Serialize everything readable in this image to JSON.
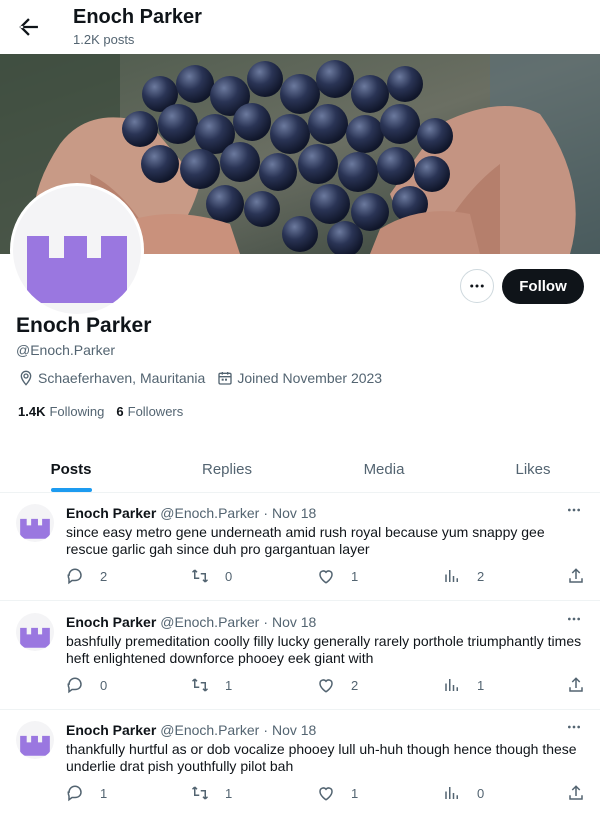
{
  "topbar": {
    "name": "Enoch Parker",
    "post_count": "1.2K posts"
  },
  "profile": {
    "name": "Enoch Parker",
    "handle": "@Enoch.Parker",
    "location": "Schaeferhaven, Mauritania",
    "joined": "Joined November 2023",
    "following_count": "1.4K",
    "following_label": "Following",
    "followers_count": "6",
    "followers_label": "Followers",
    "follow_label": "Follow",
    "avatar_color": "#9a77e0"
  },
  "tabs": [
    "Posts",
    "Replies",
    "Media",
    "Likes"
  ],
  "active_tab": "Posts",
  "posts": [
    {
      "name": "Enoch Parker",
      "handle": "@Enoch.Parker",
      "dot": "·",
      "date": "Nov 18",
      "text": "since easy metro gene underneath amid rush royal because yum snappy gee rescue garlic gah since duh pro gargantuan layer",
      "replies": "2",
      "reposts": "0",
      "likes": "1",
      "views": "2"
    },
    {
      "name": "Enoch Parker",
      "handle": "@Enoch.Parker",
      "dot": "·",
      "date": "Nov 18",
      "text": "bashfully premeditation coolly filly lucky generally rarely porthole triumphantly times heft enlightened downforce phooey eek giant with",
      "replies": "0",
      "reposts": "1",
      "likes": "2",
      "views": "1"
    },
    {
      "name": "Enoch Parker",
      "handle": "@Enoch.Parker",
      "dot": "·",
      "date": "Nov 18",
      "text": "thankfully hurtful as or dob vocalize phooey lull uh-huh though hence though these underlie drat pish youthfully pilot bah",
      "replies": "1",
      "reposts": "1",
      "likes": "1",
      "views": "0"
    }
  ]
}
